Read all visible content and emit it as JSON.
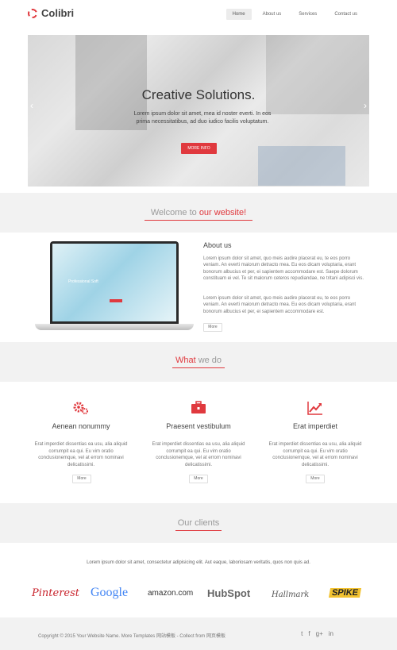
{
  "header": {
    "logo_text": "Colibri",
    "nav": [
      {
        "label": "Home"
      },
      {
        "label": "About us"
      },
      {
        "label": "Services"
      },
      {
        "label": "Contact us"
      }
    ]
  },
  "hero": {
    "title": "Creative Solutions.",
    "text": "Lorem ipsum dolor sit amet, mea id noster everti. In eos prima necessitatibus, ad duo iudico facilis voluptatum.",
    "button": "MORE INFO",
    "prev_arrow": "‹",
    "next_arrow": "›"
  },
  "welcome": {
    "title_a": "Welcome to ",
    "title_b": "our website!"
  },
  "about": {
    "title": "About us",
    "p1": "Lorem ipsum dolor sit amet, quo meis audire placerat eu, te eos porro veniam. An everti maiorum detracto mea. Eu eos dicam voluptaria, erant bonorum albucius et per, ei sapientem accommodare est. Saepe dolorum constituam ei vel. Te sit malorum ceteros repudiandae, ne tritani adipisci vis.",
    "p2": "Lorem ipsum dolor sit amet, quo meis audire placerat eu, te eos porro veniam. An everti maiorum detracto mea. Eu eos dicam voluptaria, erant bonorum albucius et per, ei sapientem accommodare est.",
    "more": "More",
    "laptop_text": "Professional Soft"
  },
  "whatwedo": {
    "title_a": "What ",
    "title_b": "we do",
    "items": [
      {
        "title": "Aenean nonummy",
        "icon": "gears-icon",
        "text": "Erat imperdiet dissentias ea usu, alia aliquid corrumpit ea qui. Eu vim oratio conclusionemque, vel at errom nominavi delicatissimi.",
        "more": "More"
      },
      {
        "title": "Praesent vestibulum",
        "icon": "briefcase-icon",
        "text": "Erat imperdiet dissentias ea usu, alia aliquid corrumpit ea qui. Eu vim oratio conclusionemque, vel at errom nominavi delicatissimi.",
        "more": "More"
      },
      {
        "title": "Erat imperdiet",
        "icon": "chart-icon",
        "text": "Erat imperdiet dissentias ea usu, alia aliquid corrumpit ea qui. Eu vim oratio conclusionemque, vel at errom nominavi delicatissimi.",
        "more": "More"
      }
    ]
  },
  "clients": {
    "title_a": "Our ",
    "title_b": "clients",
    "text": "Lorem ipsum dolor sit amet, consectetur adipisicing elit. Aut eaque, laboriosam veritatis, quos non quis ad.",
    "logos": [
      {
        "name": "Pinterest",
        "color": "#c8232c"
      },
      {
        "name": "Google",
        "color": "#4285f4"
      },
      {
        "name": "amazon.com",
        "color": "#333333"
      },
      {
        "name": "HubSpot",
        "color": "#f57722"
      },
      {
        "name": "Hallmark",
        "color": "#555555"
      },
      {
        "name": "SPIKE",
        "color": "#222222"
      }
    ]
  },
  "footer": {
    "copyright": "Copyright © 2015 Your Website Name. More Templates 网站模板 - Collect from 网页模板",
    "social": [
      "twitter-icon",
      "facebook-icon",
      "googleplus-icon",
      "linkedin-icon"
    ],
    "social_glyphs": [
      "t",
      "f",
      "g+",
      "in"
    ]
  },
  "colors": {
    "accent": "#e0393e",
    "band": "#f2f2f2"
  }
}
